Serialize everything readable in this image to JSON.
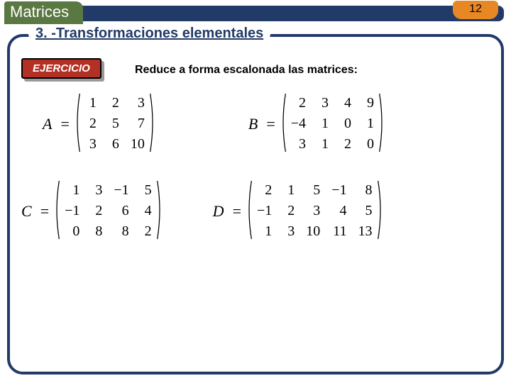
{
  "header": {
    "tab": "Matrices",
    "page_number": "12",
    "subtitle": "3. -Transformaciones elementales"
  },
  "exercise": {
    "badge": "EJERCICIO",
    "instruction": "Reduce a forma escalonada las matrices:"
  },
  "matrices": {
    "A": {
      "name": "A",
      "rows": [
        [
          "1",
          "2",
          "3"
        ],
        [
          "2",
          "5",
          "7"
        ],
        [
          "3",
          "6",
          "10"
        ]
      ]
    },
    "B": {
      "name": "B",
      "rows": [
        [
          "2",
          "3",
          "4",
          "9"
        ],
        [
          "−4",
          "1",
          "0",
          "1"
        ],
        [
          "3",
          "1",
          "2",
          "0"
        ]
      ]
    },
    "C": {
      "name": "C",
      "rows": [
        [
          "1",
          "3",
          "−1",
          "5"
        ],
        [
          "−1",
          "2",
          "6",
          "4"
        ],
        [
          "0",
          "8",
          "8",
          "2"
        ]
      ]
    },
    "D": {
      "name": "D",
      "rows": [
        [
          "2",
          "1",
          "5",
          "−1",
          "8"
        ],
        [
          "−1",
          "2",
          "3",
          "4",
          "5"
        ],
        [
          "1",
          "3",
          "10",
          "11",
          "13"
        ]
      ]
    }
  }
}
